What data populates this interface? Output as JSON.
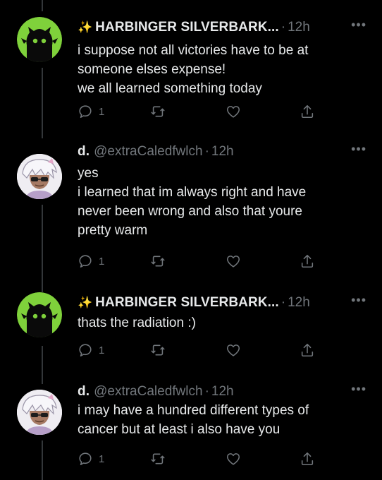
{
  "tweets": [
    {
      "author": {
        "sparkle": "✨",
        "display_name": "HARBINGER SILVERBARK...",
        "handle": "",
        "avatar": "green-creature-avatar"
      },
      "separator": "·",
      "time": "12h",
      "more": "•••",
      "lines": [
        "i suppose not all victories have to be at",
        "someone elses expense!",
        "we all learned something today"
      ],
      "reply_count": "1"
    },
    {
      "author": {
        "sparkle": "",
        "display_name": "d.",
        "handle": "@extraCaledfwlch",
        "avatar": "white-haired-character-avatar"
      },
      "separator": "·",
      "time": "12h",
      "more": "•••",
      "lines": [
        "yes",
        "i learned that im always right and have",
        "never been wrong and also that youre",
        "pretty warm"
      ],
      "reply_count": "1"
    },
    {
      "author": {
        "sparkle": "✨",
        "display_name": "HARBINGER SILVERBARK...",
        "handle": "",
        "avatar": "green-creature-avatar"
      },
      "separator": "·",
      "time": "12h",
      "more": "•••",
      "lines": [
        "thats the radiation :)"
      ],
      "reply_count": "1"
    },
    {
      "author": {
        "sparkle": "",
        "display_name": "d.",
        "handle": "@extraCaledfwlch",
        "avatar": "white-haired-character-avatar"
      },
      "separator": "·",
      "time": "12h",
      "more": "•••",
      "lines": [
        "i may have a hundred different types of",
        "cancer but at least i also have you"
      ],
      "reply_count": "1"
    }
  ],
  "colors": {
    "background": "#000000",
    "text": "#e7e9ea",
    "muted": "#71767b",
    "thread_line": "#333639",
    "avatar_green": "#7fd13b",
    "sparkle": "#f5d74a"
  }
}
